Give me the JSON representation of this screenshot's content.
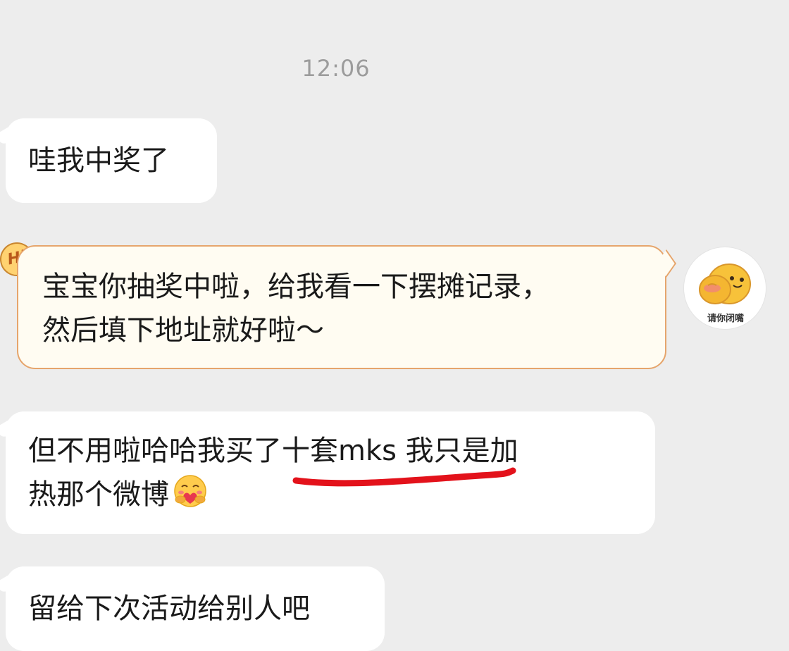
{
  "chat": {
    "timestamp": "12:06",
    "messages": [
      {
        "direction": "incoming",
        "text": "哇我中奖了"
      },
      {
        "direction": "outgoing",
        "line1": "宝宝你抽奖中啦，给我看一下摆摊记录，",
        "line2": "然后填下地址就好啦～"
      },
      {
        "direction": "incoming",
        "line1": "但不用啦哈哈我买了十套mks 我只是加",
        "line2": "热那个微博",
        "emoji": "hug-face-emoji"
      },
      {
        "direction": "incoming",
        "text": "留给下次活动给别人吧"
      }
    ],
    "hi_badge": "Hi",
    "avatar_caption": "请你闭嘴",
    "annotation": {
      "type": "red-underline",
      "color": "#e3121b"
    },
    "colors": {
      "background": "#ededed",
      "incoming_bubble": "#ffffff",
      "outgoing_bubble": "#fffcf2",
      "outgoing_border": "#e6a56c"
    }
  }
}
